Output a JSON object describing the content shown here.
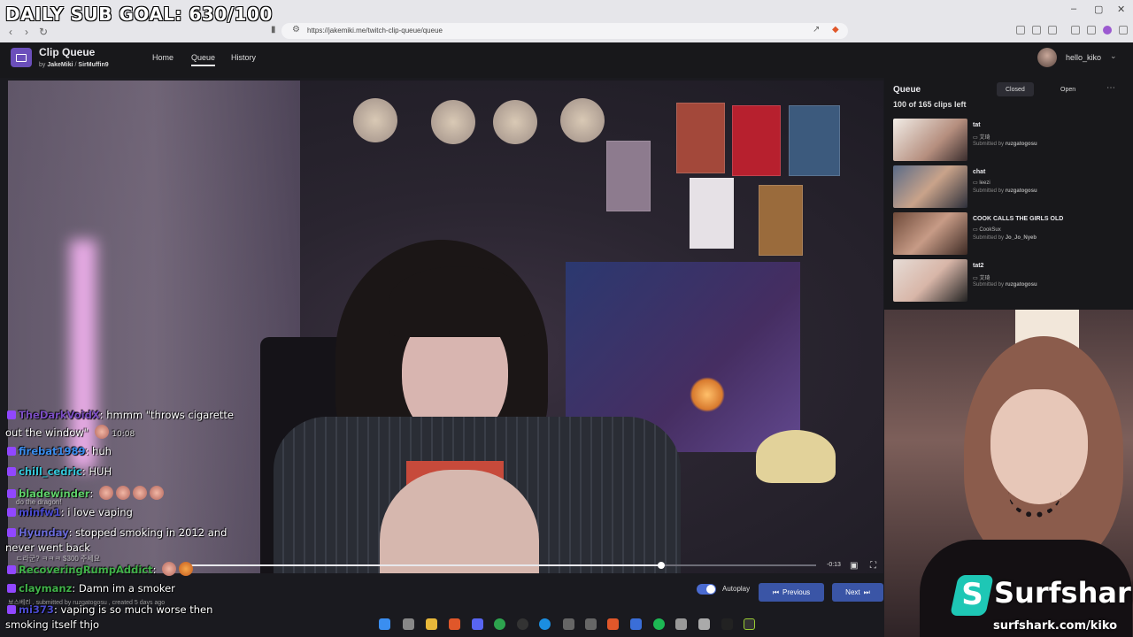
{
  "overlay": {
    "goal_text": "DAILY SUB GOAL: 630/100"
  },
  "browser": {
    "url": "https://jakemiki.me/twitch-clip-queue/queue",
    "back_glyph": "‹",
    "forward_glyph": "›",
    "reload_glyph": "↻",
    "window_controls": [
      "–",
      "▢",
      "✕"
    ]
  },
  "app": {
    "title": "Clip Queue",
    "by_prefix": "by",
    "author1": "JakeMiki",
    "author_sep": "/",
    "author2": "SirMuffin9",
    "nav": [
      "Home",
      "Queue",
      "History"
    ],
    "user_name": "hello_kiko",
    "user_chevron": "⌄"
  },
  "player": {
    "progress_fraction": 0.754,
    "time_remaining": "-0:13",
    "clip_meta": "보스베리 , submitted by ruzgatogosu , created 5 days ago",
    "autoplay_label": "Autoplay",
    "prev_label": "Previous",
    "next_label": "Next",
    "prev_icon": "⏮",
    "next_icon": "⏭"
  },
  "queue": {
    "title": "Queue",
    "tab_closed": "Closed",
    "tab_open": "Open",
    "more_glyph": "⋯",
    "count_text": "100 of 165 clips left",
    "items": [
      {
        "name": "tat",
        "channel": "艾琦",
        "submitted_prefix": "Submitted by",
        "submitter": "ruzgatogosu"
      },
      {
        "name": "chat",
        "channel": "leezi",
        "submitted_prefix": "Submitted by",
        "submitter": "ruzgatogosu"
      },
      {
        "name": "COOK CALLS THE GIRLS OLD",
        "channel": "CookSux",
        "submitted_prefix": "Submitted by",
        "submitter": "Jo_Jo_Nyeb"
      },
      {
        "name": "tat2",
        "channel": "艾琦",
        "submitted_prefix": "Submitted by",
        "submitter": "ruzgatogosu"
      }
    ]
  },
  "chat": {
    "lines": [
      {
        "user": "TheDarkVoidX",
        "color": "#7d4fc4",
        "text": "hmmm \"throws cigarette",
        "cont": "out the window\"",
        "time": "10:08"
      },
      {
        "user": "firebat1989",
        "color": "#3a8ef0",
        "text": "huh"
      },
      {
        "user": "chill_cedric",
        "color": "#35c6d9",
        "text": "HUH"
      },
      {
        "user": "bladewinder",
        "color": "#5fd06a",
        "text": ""
      },
      {
        "user": "minfw1",
        "color": "#4a4acd",
        "text": "i love vaping"
      },
      {
        "user": "Hyunday",
        "color": "#6a6ad8",
        "text": "stopped smoking in 2012 and",
        "cont": "never went back"
      },
      {
        "user": "RecoveringRumpAddict",
        "color": "#41b24a",
        "text": ""
      },
      {
        "user": "claymanz",
        "color": "#41b24a",
        "text": "Damn im a smoker"
      },
      {
        "user": "mi373",
        "color": "#4a4acd",
        "text": "vaping is so much worse then",
        "cont": "smoking itself thjo"
      }
    ],
    "ghost_1": "do the dragon!",
    "ghost_2": "ㄷ라군? ㅋㅋㅋ $300 주세요"
  },
  "sponsor": {
    "brand": "Surfshark",
    "reg": "®",
    "url": "surfshark.com/kiko"
  },
  "colors": {
    "accent": "#3a55a6",
    "app_bg": "#18181b",
    "twitch_purple": "#9147ff",
    "surfshark_teal": "#1ec7b5"
  }
}
